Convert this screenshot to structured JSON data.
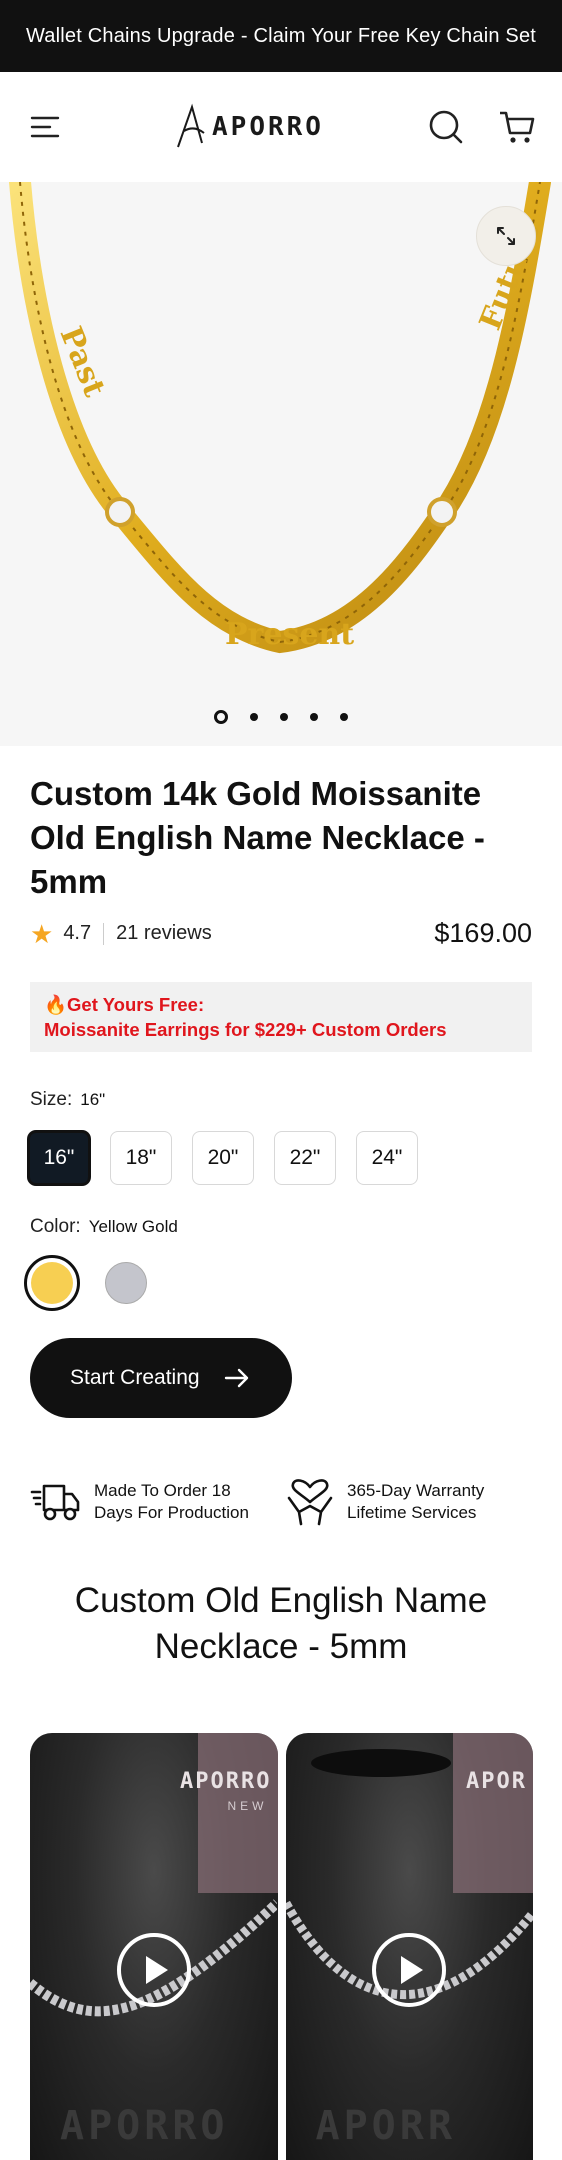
{
  "announcement": {
    "text": "Wallet Chains Upgrade - Claim Your Free Key Chain Set"
  },
  "header": {
    "logo_text": "APORRO",
    "menu_icon": "hamburger-menu-icon",
    "search_icon": "search-icon",
    "cart_icon": "cart-icon"
  },
  "gallery": {
    "image_alt": "Gold cuban link necklace with Old English name plates",
    "plate_texts": [
      "Past",
      "Present",
      "Future"
    ],
    "expand_icon": "expand-arrows-icon",
    "slide_count": 5,
    "active_slide": 1
  },
  "product": {
    "title": "Custom 14k Gold Moissanite Old English Name Necklace - 5mm",
    "rating": "4.7",
    "reviews": "21 reviews",
    "price": "$169.00"
  },
  "promo": {
    "icon": "🔥",
    "line1": "Get Yours Free:",
    "line2": "Moissanite Earrings for $229+ Custom Orders"
  },
  "size": {
    "label": "Size:",
    "selected": "16\"",
    "options": [
      "16\"",
      "18\"",
      "20\"",
      "22\"",
      "24\""
    ]
  },
  "color": {
    "label": "Color:",
    "selected": "Yellow Gold",
    "options": [
      {
        "name": "Yellow Gold",
        "hex": "#f7cf52"
      },
      {
        "name": "White Gold",
        "hex": "#c4c5cc"
      }
    ]
  },
  "cta": {
    "label": "Start Creating",
    "icon": "arrow-right-icon"
  },
  "features": [
    {
      "icon": "delivery-truck-icon",
      "line1": "Made To Order 18",
      "line2": "Days For Production"
    },
    {
      "icon": "heart-hands-icon",
      "line1": "365-Day Warranty",
      "line2": "Lifetime Services"
    }
  ],
  "section": {
    "title_line1": "Custom Old English Name",
    "title_line2": "Necklace - 5mm"
  },
  "videos": [
    {
      "overlay_text": "APORRO",
      "overlay_sub": "NEW",
      "watermark": "APORRO",
      "icon": "play-icon"
    },
    {
      "overlay_text": "APOR",
      "overlay_sub": "",
      "watermark": "APORR",
      "icon": "play-icon"
    }
  ],
  "colors": {
    "accent_red": "#e0161d",
    "dark": "#111111",
    "star": "#f5a623",
    "gold": "#e6b522"
  }
}
